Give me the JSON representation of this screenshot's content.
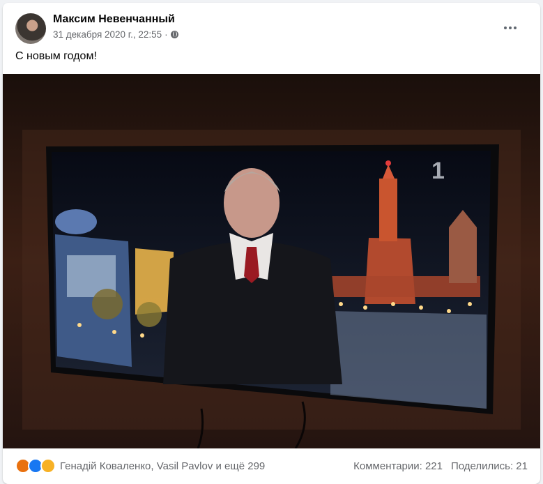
{
  "post": {
    "author": "Максим Невенчанный",
    "date": "31 декабря 2020 г., 22:55",
    "separator": "·",
    "text": "С новым годом!"
  },
  "icons": {
    "avatar": "avatar",
    "privacy": "globe-icon",
    "menu": "more-horiz-icon",
    "reactions": [
      "angry-reaction-icon",
      "like-reaction-icon",
      "haha-reaction-icon"
    ]
  },
  "footer": {
    "reaction_names": "Генадій Коваленко, Vasil Pavlov и ещё 299",
    "comments": "Комментарии: 221",
    "shares": "Поделились: 21"
  },
  "colors": {
    "author": "#050505",
    "meta": "#65676b",
    "like": "#1877f2",
    "angry": "#e9710f",
    "haha": "#f7b125"
  }
}
